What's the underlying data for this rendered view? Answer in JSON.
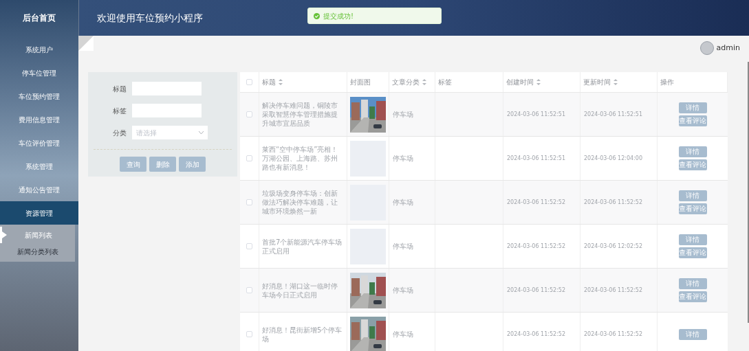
{
  "sidebar": {
    "title": "后台首页",
    "items": [
      {
        "label": "系统用户",
        "selected": false
      },
      {
        "label": "停车位管理",
        "selected": false
      },
      {
        "label": "车位预约管理",
        "selected": false
      },
      {
        "label": "费用信息管理",
        "selected": false
      },
      {
        "label": "车位评价管理",
        "selected": false
      },
      {
        "label": "系统管理",
        "selected": false
      },
      {
        "label": "通知公告管理",
        "selected": false
      },
      {
        "label": "资源管理",
        "selected": true,
        "expanded": true,
        "children": [
          {
            "label": "新闻列表",
            "selected": true
          },
          {
            "label": "新闻分类列表",
            "selected": false
          }
        ]
      }
    ]
  },
  "header": {
    "title": "欢迎使用车位预约小程序"
  },
  "toast": {
    "message": "提交成功!"
  },
  "user": {
    "name": "admin"
  },
  "filter": {
    "fields": [
      {
        "kind": "text",
        "label": "标题"
      },
      {
        "kind": "text",
        "label": "标签"
      },
      {
        "kind": "select",
        "label": "分类",
        "placeholder": "请选择"
      }
    ],
    "buttons": [
      "查询",
      "删除",
      "添加"
    ]
  },
  "table": {
    "select_all": {
      "checked": false
    },
    "columns": [
      {
        "label": "标题",
        "sortable": true
      },
      {
        "label": "封面图",
        "sortable": false
      },
      {
        "label": "文章分类",
        "sortable": true
      },
      {
        "label": "标签",
        "sortable": false
      },
      {
        "label": "创建时间",
        "sortable": true
      },
      {
        "label": "更新时间",
        "sortable": true
      },
      {
        "label": "操作",
        "sortable": false
      }
    ],
    "rows": [
      {
        "checked": false,
        "title": "解决停车难问题，铜陵市采取智慧停车管理措施提升城市宜居品质",
        "cover": {
          "kind": "picture"
        },
        "category": "停车场",
        "created": "2024-03-06 11:52:51",
        "updated": "2024-03-06 11:52:51",
        "actions": [
          "详情",
          "查看评论"
        ]
      },
      {
        "checked": false,
        "title": "莱西“空中停车场”亮相！万湖公园、上海路、苏州路也有新消息！",
        "cover": {
          "kind": "placeholder"
        },
        "category": "停车场",
        "created": "2024-03-06 11:52:51",
        "updated": "2024-03-06 12:04:00",
        "actions": [
          "详情",
          "查看评论"
        ]
      },
      {
        "checked": false,
        "title": "垃圾场变身停车场：创新做法巧解决停车难题，让城市环境焕然一新",
        "cover": {
          "kind": "placeholder"
        },
        "category": "停车场",
        "created": "2024-03-06 11:52:52",
        "updated": "2024-03-06 11:52:52",
        "actions": [
          "详情",
          "查看评论"
        ]
      },
      {
        "checked": false,
        "title": "首批7个新能源汽车停车场正式启用",
        "cover": {
          "kind": "placeholder"
        },
        "category": "停车场",
        "created": "2024-03-06 11:52:52",
        "updated": "2024-03-06 12:02:52",
        "actions": [
          "详情",
          "查看评论"
        ]
      },
      {
        "checked": false,
        "title": "好消息！湖口这一临时停车场今日正式启用",
        "cover": {
          "kind": "picture"
        },
        "category": "停车场",
        "created": "2024-03-06 11:52:52",
        "updated": "2024-03-06 11:52:52",
        "actions": [
          "详情",
          "查看评论"
        ]
      },
      {
        "checked": false,
        "title": "好消息！昆街新增5个停车场",
        "cover": {
          "kind": "picture"
        },
        "category": "停车场",
        "created": "2024-03-06 11:52:52",
        "updated": "2024-03-06 11:52:52",
        "actions": [
          "详情"
        ]
      }
    ]
  }
}
